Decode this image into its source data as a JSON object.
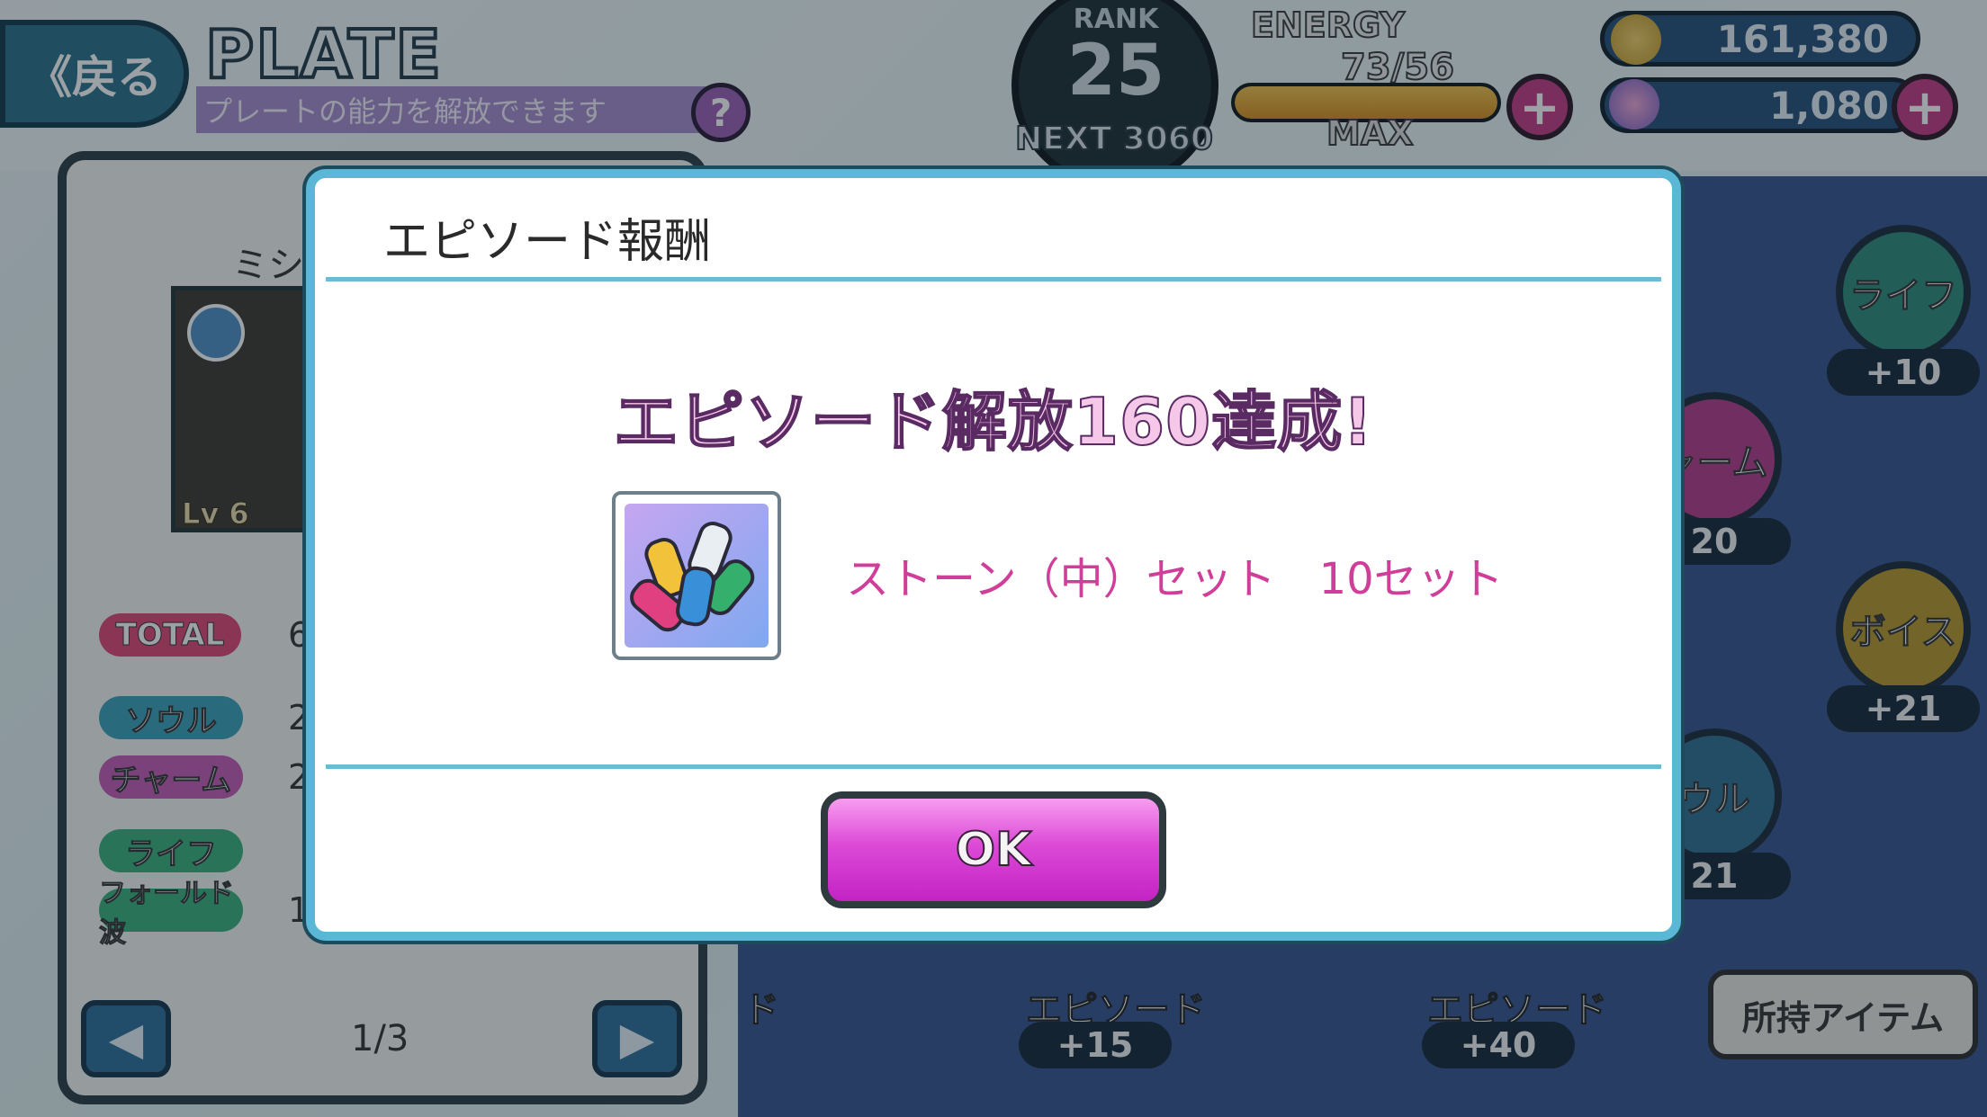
{
  "header": {
    "back_label": "《戻る",
    "title": "PLATE",
    "subtitle": "プレートの能力を解放できます",
    "help_label": "?",
    "rank_label": "RANK",
    "rank_value": "25",
    "next_label": "NEXT 3060",
    "energy_label": "ENERGY",
    "energy_value": "73/56",
    "energy_max_label": "MAX",
    "energy_fill": 1.0,
    "coins": "161,380",
    "gems": "1,080",
    "plus_label": "+"
  },
  "left_panel": {
    "character_name": "ミシ",
    "level": "Lv 6",
    "stats": [
      {
        "label": "TOTAL",
        "value": "6",
        "color": "#e04673"
      },
      {
        "label": "ソウル",
        "value": "2",
        "color": "#3aa0b8"
      },
      {
        "label": "チャーム",
        "value": "2",
        "color": "#c45ab5"
      },
      {
        "label": "ライフ",
        "value": "",
        "color": "#3ab07c"
      },
      {
        "label": "フォールド波",
        "value": "1",
        "color": "#3ab07c"
      }
    ],
    "page_indicator": "1/3",
    "prev_arrow": "◀",
    "next_arrow": "▶"
  },
  "right_panel": {
    "circles": [
      {
        "label": "ライフ",
        "bonus": "+10"
      },
      {
        "label": "ャーム",
        "bonus": "20"
      },
      {
        "label": "ボイス",
        "bonus": "+21"
      },
      {
        "label": "ウル",
        "bonus": "21"
      }
    ],
    "bottom_items": [
      {
        "label": "ド",
        "bonus": ""
      },
      {
        "label": "エピソード",
        "bonus": "+15"
      },
      {
        "label": "エピソード",
        "bonus": "+40"
      }
    ],
    "owned_items_label": "所持アイテム"
  },
  "modal": {
    "title": "エピソード報酬",
    "achievement": "エピソード解放160達成!",
    "reward_text": "ストーン（中）セット　10セット",
    "ok_label": "OK",
    "item_icon": "gem-set-icon"
  }
}
